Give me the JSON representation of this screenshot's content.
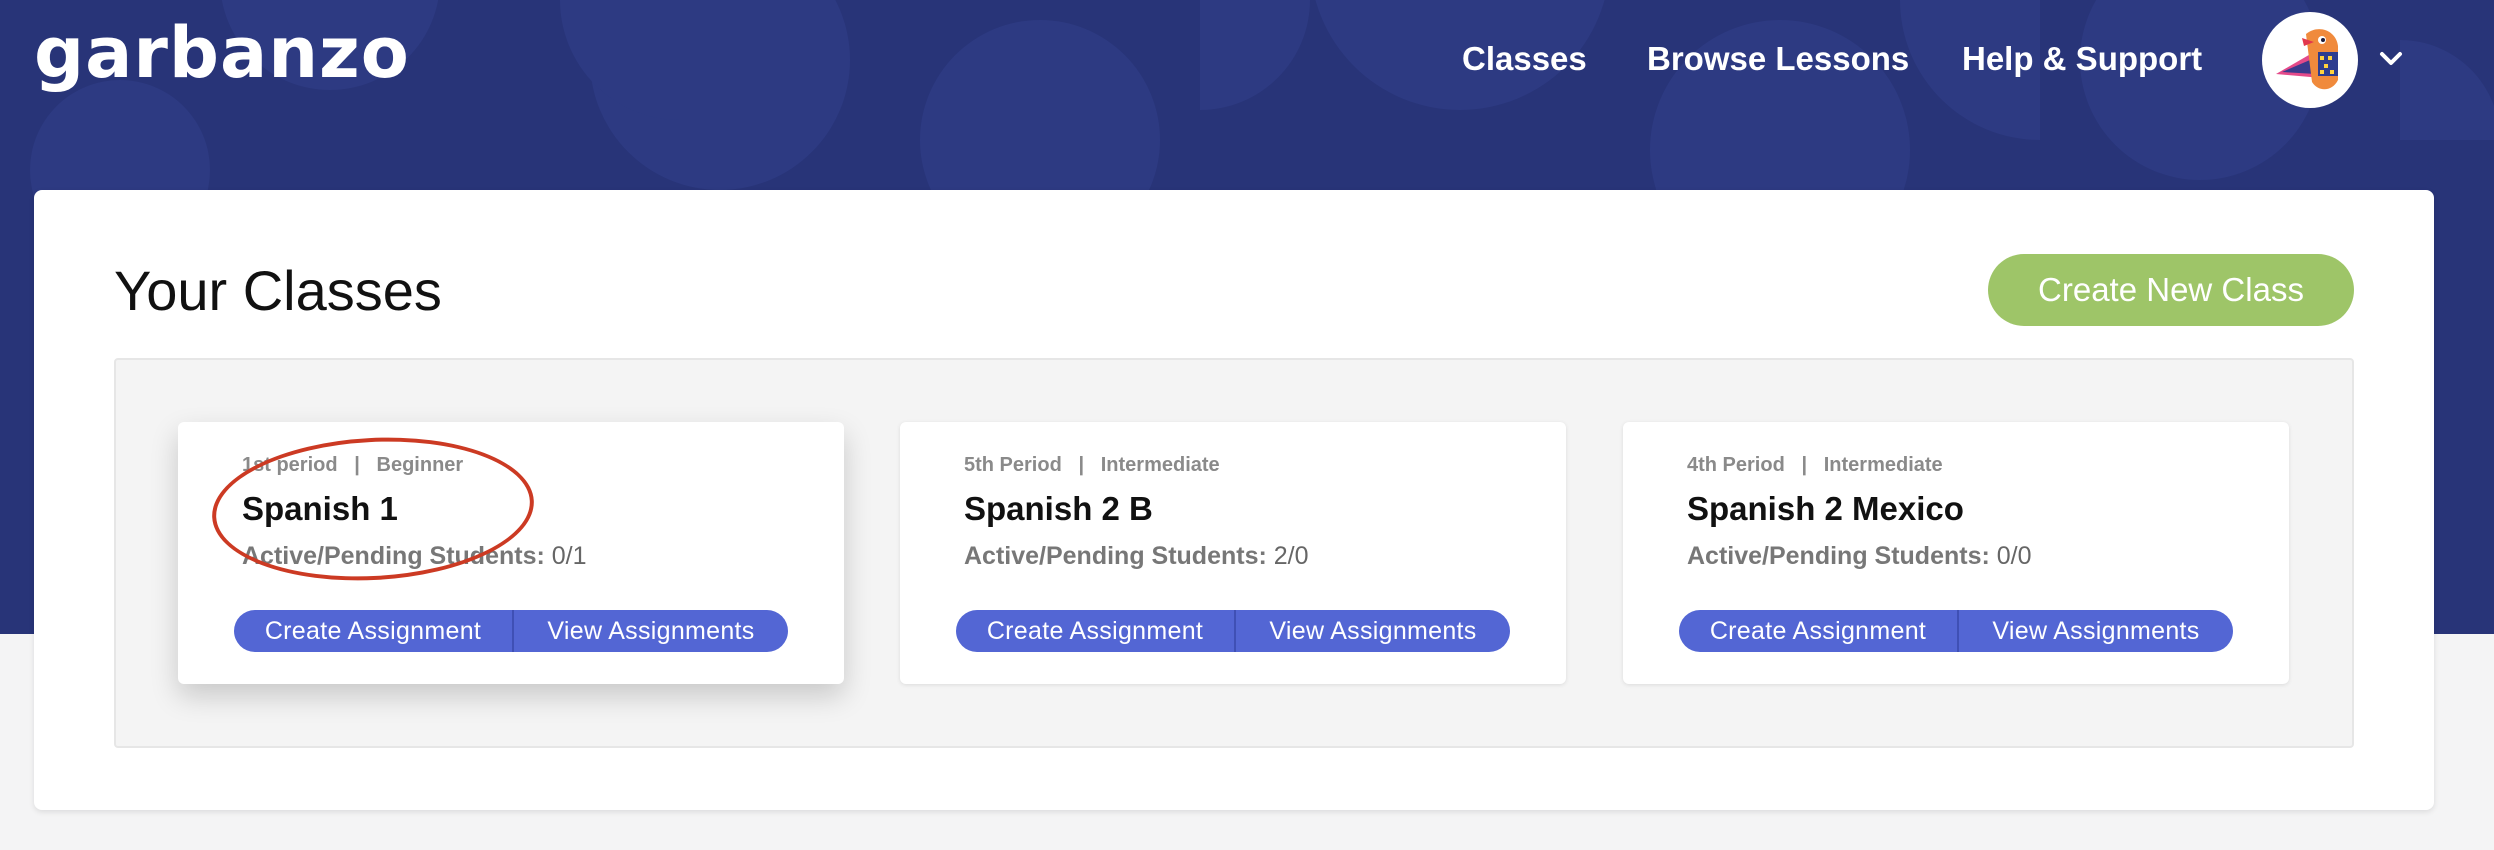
{
  "header": {
    "logo": "garbanzo",
    "nav": [
      "Classes",
      "Browse Lessons",
      "Help & Support"
    ]
  },
  "page": {
    "title": "Your Classes",
    "create_button": "Create New Class"
  },
  "classes": [
    {
      "meta": "1st period   |   Beginner",
      "name": "Spanish 1",
      "students_label": "Active/Pending Students:",
      "students_value": "0/1",
      "create_label": "Create Assignment",
      "view_label": "View Assignments"
    },
    {
      "meta": "5th Period   |   Intermediate",
      "name": "Spanish 2 B",
      "students_label": "Active/Pending Students:",
      "students_value": "2/0",
      "create_label": "Create Assignment",
      "view_label": "View Assignments"
    },
    {
      "meta": "4th Period   |   Intermediate",
      "name": "Spanish 2 Mexico",
      "students_label": "Active/Pending Students:",
      "students_value": "0/0",
      "create_label": "Create Assignment",
      "view_label": "View Assignments"
    }
  ],
  "colors": {
    "header_bg": "#283478",
    "accent_green": "#9ec568",
    "button_blue": "#5366d4",
    "annotation_red": "#cc3a23"
  },
  "icons": {
    "avatar": "bird-avatar-icon",
    "account_menu": "chevron-down-icon"
  }
}
